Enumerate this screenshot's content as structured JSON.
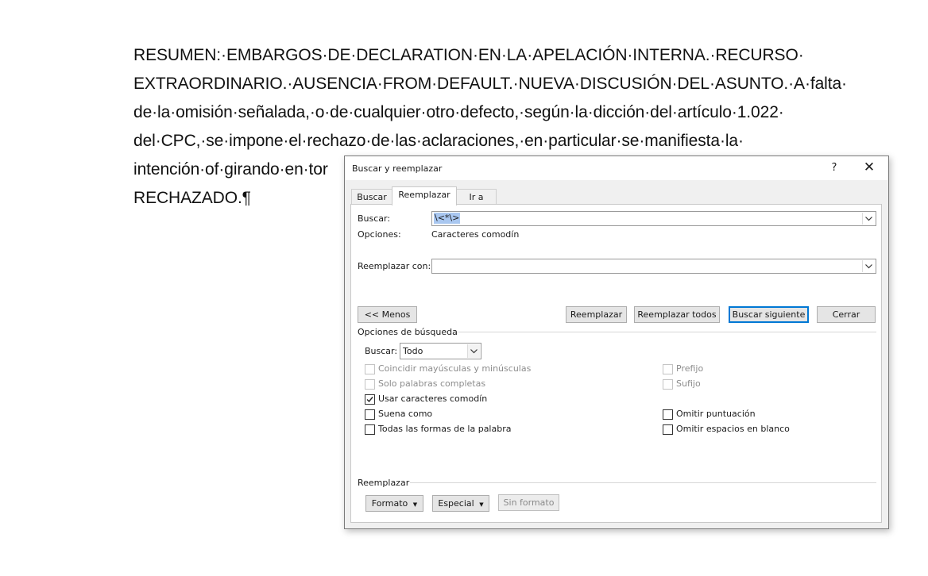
{
  "document": {
    "lines": [
      "RESUMEN:·EMBARGOS·DE·DECLARATION·EN·LA·APELACIÓN·INTERNA.·RECURSO·",
      "EXTRAORDINARIO.·AUSENCIA·FROM·DEFAULT.·NUEVA·DISCUSIÓN·DEL·ASUNTO.·A·falta·",
      "de·la·omisión·señalada,·o·de·cualquier·otro·defecto,·según·la·dicción·del·artículo·1.022·",
      "del·CPC,·se·impone·el·rechazo·de·las·aclaraciones,·en·particular·se·manifiesta·la·",
      "intención·of·girando·en·tor",
      "RECHAZADO.¶"
    ]
  },
  "dialog": {
    "title": "Buscar y reemplazar",
    "help_glyph": "?",
    "close_glyph": "✕",
    "tabs": [
      "Buscar",
      "Reemplazar",
      "Ir a"
    ],
    "find_label": "Buscar:",
    "find_value": "\\<*\\>",
    "options_label": "Opciones:",
    "options_value": "Caracteres comodín",
    "replace_label": "Reemplazar con:",
    "replace_value": "",
    "buttons": {
      "less": "<< Menos",
      "replace": "Reemplazar",
      "replace_all": "Reemplazar todos",
      "find_next": "Buscar siguiente",
      "close": "Cerrar"
    },
    "search_options_heading": "Opciones de búsqueda",
    "search_dir_label": "Buscar:",
    "search_dir_value": "Todo",
    "checkboxes_left": [
      {
        "label": "Coincidir mayúsculas y minúsculas",
        "checked": false,
        "disabled": true
      },
      {
        "label": "Solo palabras completas",
        "checked": false,
        "disabled": true
      },
      {
        "label": "Usar caracteres comodín",
        "checked": true,
        "disabled": false
      },
      {
        "label": "Suena como",
        "checked": false,
        "disabled": false
      },
      {
        "label": "Todas las formas de la palabra",
        "checked": false,
        "disabled": false
      }
    ],
    "checkboxes_right": [
      {
        "label": "Prefijo",
        "checked": false,
        "disabled": true
      },
      {
        "label": "Sufijo",
        "checked": false,
        "disabled": true
      },
      {
        "label": "Omitir puntuación",
        "checked": false,
        "disabled": false
      },
      {
        "label": "Omitir espacios en blanco",
        "checked": false,
        "disabled": false
      }
    ],
    "replace_heading": "Reemplazar",
    "format_button": "Formato",
    "special_button": "Especial",
    "no_format_button": "Sin formato"
  }
}
